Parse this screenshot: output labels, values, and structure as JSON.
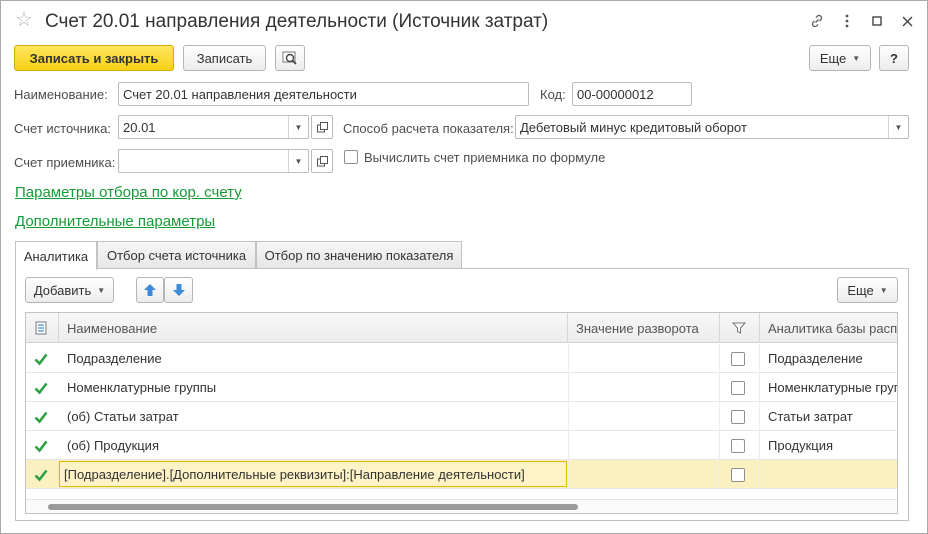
{
  "window": {
    "title": "Счет 20.01 направления деятельности (Источник затрат)"
  },
  "toolbar": {
    "save_close_label": "Записать и закрыть",
    "save_label": "Записать",
    "more_label": "Еще",
    "help_label": "?"
  },
  "form": {
    "name_label": "Наименование:",
    "name_value": "Счет 20.01 направления деятельности",
    "code_label": "Код:",
    "code_value": "00-00000012",
    "source_account_label": "Счет источника:",
    "source_account_value": "20.01",
    "method_label": "Способ расчета показателя:",
    "method_value": "Дебетовый минус кредитовый оборот",
    "receiver_account_label": "Счет приемника:",
    "receiver_account_value": "",
    "formula_checkbox_label": "Вычислить счет приемника по формуле"
  },
  "links": {
    "filter_params": "Параметры отбора по кор. счету",
    "extra_params": "Дополнительные параметры"
  },
  "tabs": [
    {
      "label": "Аналитика",
      "active": true
    },
    {
      "label": "Отбор счета источника",
      "active": false
    },
    {
      "label": "Отбор по значению показателя",
      "active": false
    }
  ],
  "table_toolbar": {
    "add_label": "Добавить",
    "more_label": "Еще"
  },
  "table": {
    "columns": [
      "Наименование",
      "Значение разворота",
      "Аналитика базы распр"
    ],
    "rows": [
      {
        "checked": true,
        "name": "Подразделение",
        "value": "",
        "flag": false,
        "base": "Подразделение"
      },
      {
        "checked": true,
        "name": "Номенклатурные группы",
        "value": "",
        "flag": false,
        "base": "Номенклатурные группы"
      },
      {
        "checked": true,
        "name": "(об) Статьи затрат",
        "value": "",
        "flag": false,
        "base": "Статьи затрат"
      },
      {
        "checked": true,
        "name": "(об) Продукция",
        "value": "",
        "flag": false,
        "base": "Продукция"
      },
      {
        "checked": true,
        "name": "[Подразделение].[Дополнительные реквизиты]:[Направление деятельности]",
        "value": "",
        "flag": false,
        "base": ""
      }
    ]
  },
  "colors": {
    "primary_button": "#f7d117",
    "link": "#169b36",
    "check_green": "#2ea043",
    "selected_row": "#fbf0c0"
  }
}
